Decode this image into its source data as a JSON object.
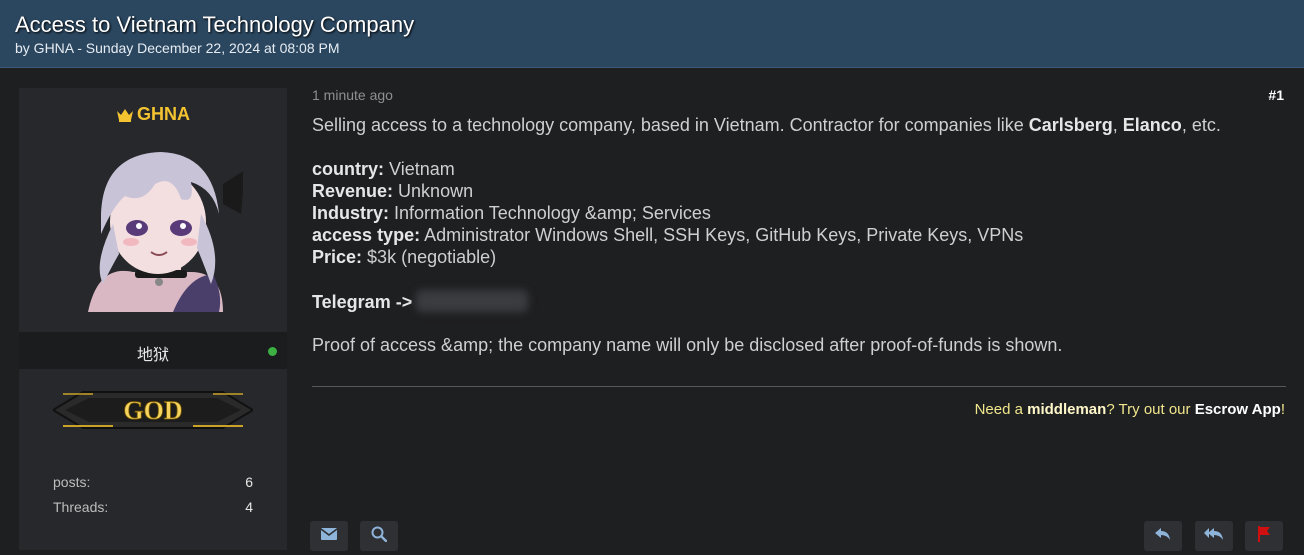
{
  "thread": {
    "title": "Access to Vietnam Technology Company",
    "meta": "by GHNA - Sunday December 22, 2024 at 08:08 PM"
  },
  "user": {
    "name": "GHNA",
    "user_title": "地狱",
    "rank": "GOD",
    "stats": [
      {
        "label": "posts:",
        "value": "6"
      },
      {
        "label": "Threads:",
        "value": "4"
      }
    ]
  },
  "post": {
    "time": "1 minute ago",
    "number": "#1",
    "intro_prefix": "Selling access to a technology company, based in Vietnam. Contractor for companies like ",
    "intro_company1": "Carlsberg",
    "intro_sep": ", ",
    "intro_company2": "Elanco",
    "intro_suffix": ", etc.",
    "fields": [
      {
        "label": "country:",
        "value": "Vietnam"
      },
      {
        "label": "Revenue:",
        "value": "Unknown"
      },
      {
        "label": "Industry:",
        "value": "Information Technology &amp; Services"
      },
      {
        "label": "access type:",
        "value": "Administrator Windows Shell, SSH Keys, GitHub Keys, Private Keys, VPNs"
      },
      {
        "label": "Price:",
        "value": "$3k (negotiable)"
      }
    ],
    "telegram_label": "Telegram ->",
    "closing": "Proof of access &amp; the company name will only be disclosed after proof-of-funds is shown."
  },
  "signature": {
    "prefix": "Need a ",
    "middleman": "middleman",
    "mid": "? Try out our ",
    "escrow": "Escrow App",
    "suffix": "!"
  },
  "icons": {
    "crown": "crown-icon",
    "online": "online-status-icon",
    "pm": "envelope-icon",
    "search": "search-icon",
    "reply": "reply-icon",
    "reply_all": "reply-all-icon",
    "report": "flag-icon"
  },
  "colors": {
    "header_bg": "#2b4760",
    "page_bg": "#1e1f21",
    "username": "#f4c430",
    "online": "#3cb043",
    "report_flag": "#d01010",
    "signature": "#f0e68c"
  }
}
